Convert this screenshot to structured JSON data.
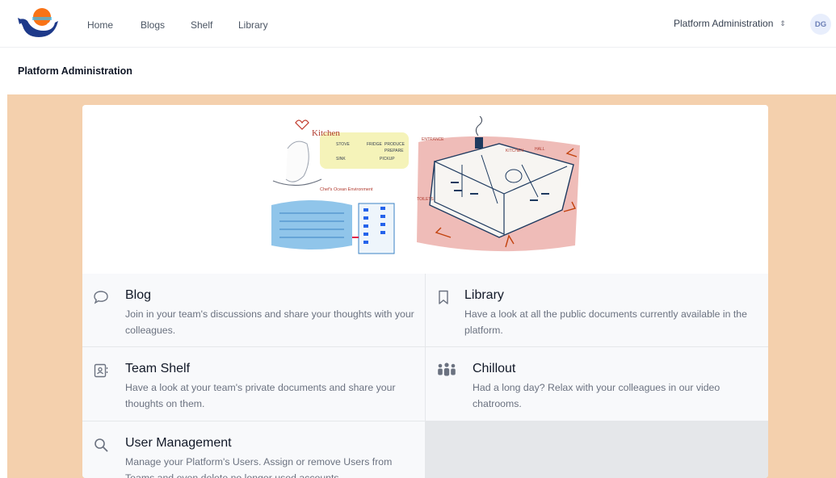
{
  "nav": {
    "links": [
      "Home",
      "Blogs",
      "Shelf",
      "Library"
    ],
    "platform_select": "Platform Administration",
    "avatar_initials": "DG"
  },
  "page": {
    "title": "Platform Administration"
  },
  "hero_labels": {
    "kitchen": "Kitchen",
    "kitchen_items": [
      "STOVE",
      "FRIDGE",
      "SINK",
      "PRODUCE",
      "PREPARE",
      "PICKUP"
    ],
    "hall": "HALL",
    "kitchen_right": "KITCHEN",
    "entrance": "ENTRANCE",
    "toilets": "TOILETS",
    "ocean": "Chef's Ocean Environment"
  },
  "tiles": [
    {
      "icon": "chat-bubble-icon",
      "title": "Blog",
      "description": "Join in your team's discussions and share your thoughts with your colleagues."
    },
    {
      "icon": "bookmark-icon",
      "title": "Library",
      "description": "Have a look at all the public documents currently available in the platform."
    },
    {
      "icon": "id-card-icon",
      "title": "Team Shelf",
      "description": "Have a look at your team's private documents and share your thoughts on them."
    },
    {
      "icon": "people-group-icon",
      "title": "Chillout",
      "description": "Had a long day? Relax with your colleagues in our video chatrooms."
    },
    {
      "icon": "search-icon",
      "title": "User Management",
      "description": "Manage your Platform's Users. Assign or remove Users from Teams and even delete no longer used accounts."
    }
  ],
  "colors": {
    "content_background": "#f4d0ad",
    "logo_blue": "#1e3a8a",
    "logo_sun": "#f97316",
    "avatar_bg": "#e8eefc"
  }
}
